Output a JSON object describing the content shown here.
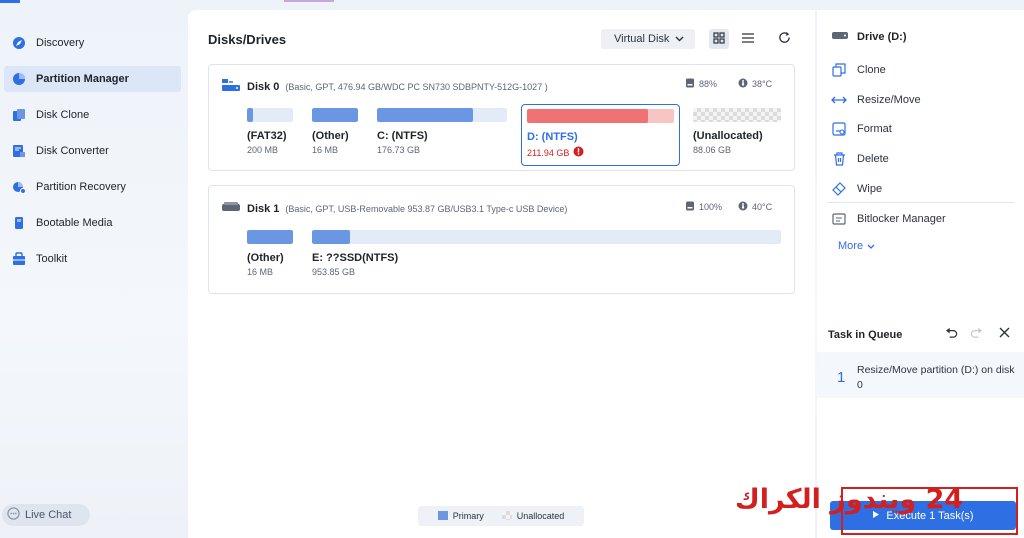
{
  "sidebar": {
    "items": [
      {
        "label": "Discovery",
        "icon": "discovery-icon",
        "active": false
      },
      {
        "label": "Partition Manager",
        "icon": "partition-manager-icon",
        "active": true
      },
      {
        "label": "Disk Clone",
        "icon": "disk-clone-icon",
        "active": false
      },
      {
        "label": "Disk Converter",
        "icon": "disk-converter-icon",
        "active": false
      },
      {
        "label": "Partition Recovery",
        "icon": "partition-recovery-icon",
        "active": false
      },
      {
        "label": "Bootable Media",
        "icon": "bootable-media-icon",
        "active": false
      },
      {
        "label": "Toolkit",
        "icon": "toolkit-icon",
        "active": false
      }
    ],
    "live_chat": "Live Chat"
  },
  "main": {
    "title": "Disks/Drives",
    "view_select": "Virtual Disk",
    "disks": [
      {
        "name": "Disk 0",
        "desc": "(Basic, GPT, 476.94 GB/WDC PC SN730 SDBPNTY-512G-1027 )",
        "health": "88%",
        "temp": "38°C",
        "partitions": [
          {
            "label": "(FAT32)",
            "size": "200 MB",
            "used_fraction": 0.12
          },
          {
            "label": "(Other)",
            "size": "16 MB",
            "used_fraction": 1.0
          },
          {
            "label": "C: (NTFS)",
            "size": "176.73 GB",
            "used_fraction": 0.74
          },
          {
            "label": "D: (NTFS)",
            "size": "211.94 GB",
            "used_fraction": 0.82,
            "selected": true,
            "warning": true
          },
          {
            "label": "(Unallocated)",
            "size": "88.06 GB",
            "unallocated": true
          }
        ]
      },
      {
        "name": "Disk 1",
        "desc": "(Basic, GPT, USB-Removable 953.87 GB/USB3.1 Type-c USB Device)",
        "health": "100%",
        "temp": "40°C",
        "partitions": [
          {
            "label": "(Other)",
            "size": "16 MB",
            "used_fraction": 1.0
          },
          {
            "label": "E: ??SSD(NTFS)",
            "size": "953.85 GB",
            "used_fraction": 0.08
          }
        ]
      }
    ],
    "legend": {
      "primary": "Primary",
      "unallocated": "Unallocated"
    }
  },
  "right": {
    "drive_title": "Drive (D:)",
    "actions": [
      {
        "label": "Clone",
        "icon": "clone-icon"
      },
      {
        "label": "Resize/Move",
        "icon": "resize-move-icon"
      },
      {
        "label": "Format",
        "icon": "format-icon"
      },
      {
        "label": "Delete",
        "icon": "delete-icon"
      },
      {
        "label": "Wipe",
        "icon": "wipe-icon"
      },
      {
        "label": "Bitlocker Manager",
        "icon": "bitlocker-icon"
      }
    ],
    "more": "More",
    "queue_title": "Task in Queue",
    "queue_items": [
      {
        "num": "1",
        "text": "Resize/Move partition (D:) on disk 0"
      }
    ],
    "execute_label": "Execute 1 Task(s)"
  },
  "watermark": {
    "text": "24 ويندوز الكراك"
  },
  "colors": {
    "accent": "#2f6fe4",
    "partition_fill": "#6b96e1",
    "selected_fill": "#f07272",
    "warning": "#d41f1f"
  }
}
